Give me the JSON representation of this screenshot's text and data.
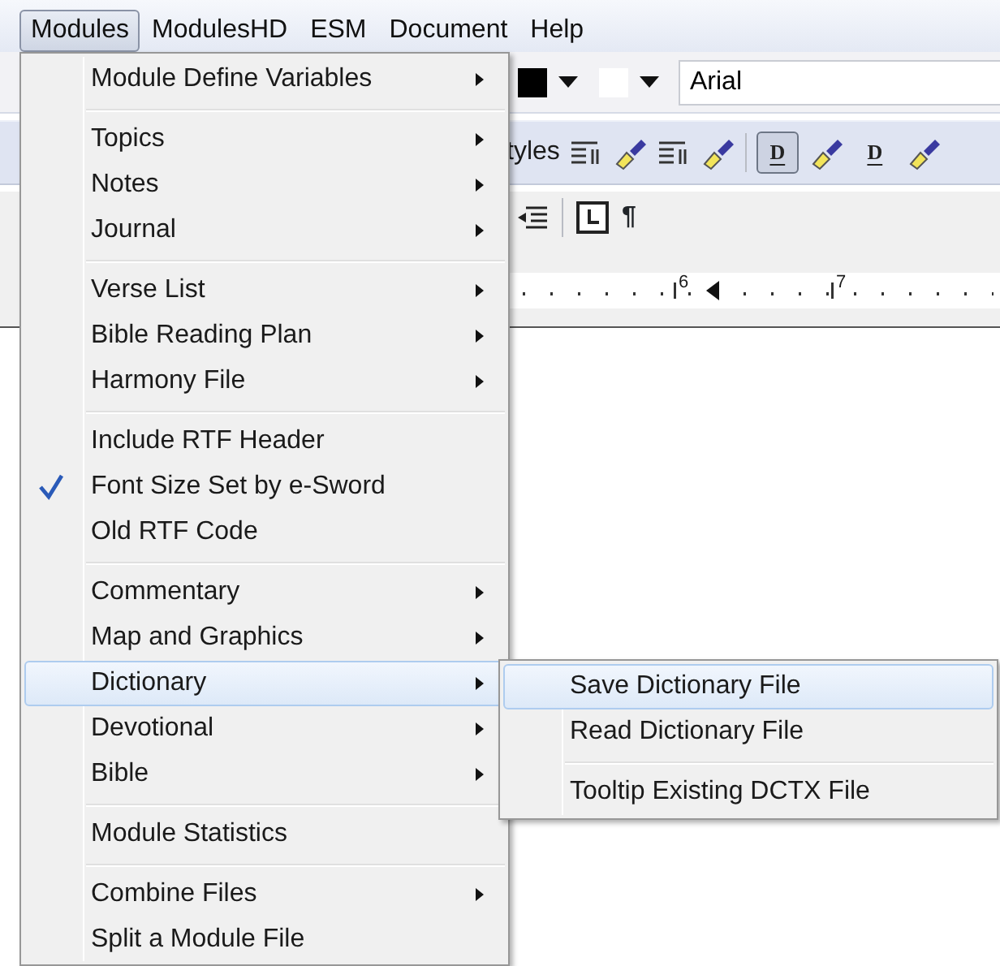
{
  "menubar": [
    {
      "label": "Modules",
      "selected": true
    },
    {
      "label": "ModulesHD",
      "selected": false
    },
    {
      "label": "ESM",
      "selected": false
    },
    {
      "label": "Document",
      "selected": false
    },
    {
      "label": "Help",
      "selected": false
    }
  ],
  "toolbar": {
    "font_field": {
      "value": "Arial"
    },
    "styles_label": "tyles",
    "style_buttons": [
      {
        "label": "D",
        "pressed": true
      },
      {
        "label": "D",
        "pressed": false
      }
    ],
    "pilcrow": "¶"
  },
  "ruler": {
    "labels": [
      "6",
      "7"
    ]
  },
  "menu": [
    {
      "kind": "item",
      "label": "Module Define Variables",
      "submenu": true,
      "checked": false,
      "selected": false
    },
    {
      "kind": "separator"
    },
    {
      "kind": "item",
      "label": "Topics",
      "submenu": true,
      "checked": false,
      "selected": false
    },
    {
      "kind": "item",
      "label": "Notes",
      "submenu": true,
      "checked": false,
      "selected": false
    },
    {
      "kind": "item",
      "label": "Journal",
      "submenu": true,
      "checked": false,
      "selected": false
    },
    {
      "kind": "separator"
    },
    {
      "kind": "item",
      "label": "Verse List",
      "submenu": true,
      "checked": false,
      "selected": false
    },
    {
      "kind": "item",
      "label": "Bible Reading Plan",
      "submenu": true,
      "checked": false,
      "selected": false
    },
    {
      "kind": "item",
      "label": "Harmony File",
      "submenu": true,
      "checked": false,
      "selected": false
    },
    {
      "kind": "separator"
    },
    {
      "kind": "item",
      "label": "Include RTF Header",
      "submenu": false,
      "checked": false,
      "selected": false
    },
    {
      "kind": "item",
      "label": "Font Size Set by e-Sword",
      "submenu": false,
      "checked": true,
      "selected": false
    },
    {
      "kind": "item",
      "label": "Old RTF Code",
      "submenu": false,
      "checked": false,
      "selected": false
    },
    {
      "kind": "separator"
    },
    {
      "kind": "item",
      "label": "Commentary",
      "submenu": true,
      "checked": false,
      "selected": false
    },
    {
      "kind": "item",
      "label": "Map and Graphics",
      "submenu": true,
      "checked": false,
      "selected": false
    },
    {
      "kind": "item",
      "label": "Dictionary",
      "submenu": true,
      "checked": false,
      "selected": true
    },
    {
      "kind": "item",
      "label": "Devotional",
      "submenu": true,
      "checked": false,
      "selected": false
    },
    {
      "kind": "item",
      "label": "Bible",
      "submenu": true,
      "checked": false,
      "selected": false
    },
    {
      "kind": "separator"
    },
    {
      "kind": "item",
      "label": "Module Statistics",
      "submenu": false,
      "checked": false,
      "selected": false
    },
    {
      "kind": "separator"
    },
    {
      "kind": "item",
      "label": "Combine Files",
      "submenu": true,
      "checked": false,
      "selected": false
    },
    {
      "kind": "item",
      "label": "Split a Module File",
      "submenu": false,
      "checked": false,
      "selected": false
    }
  ],
  "submenu": [
    {
      "kind": "item",
      "label": "Save Dictionary File",
      "selected": true
    },
    {
      "kind": "item",
      "label": "Read Dictionary File",
      "selected": false
    },
    {
      "kind": "separator"
    },
    {
      "kind": "item",
      "label": "Tooltip Existing DCTX File",
      "selected": false
    }
  ]
}
